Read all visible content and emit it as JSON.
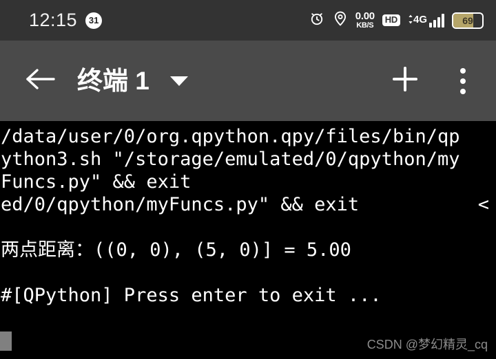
{
  "status_bar": {
    "clock": "12:15",
    "notification_count": "31",
    "alarm_icon": "alarm-clock-icon",
    "location_icon": "location-pin-icon",
    "network_speed_value": "0.00",
    "network_speed_unit": "KB/S",
    "hd_label": "HD",
    "network_type": "4G",
    "signal_bars": 4,
    "battery_level": "69",
    "battery_percent": 69,
    "battery_color": "#b5a569",
    "background_color": "#333333"
  },
  "app_bar": {
    "back_icon": "back-arrow-icon",
    "title": "终端 1",
    "dropdown_icon": "chevron-down-icon",
    "add_icon": "plus-icon",
    "overflow_icon": "more-vertical-icon",
    "background_color": "#4a4a4a"
  },
  "terminal": {
    "background_color": "#000000",
    "text_color": "#ffffff",
    "cursor_color": "#808080",
    "lines": [
      {
        "text": "/data/user/0/org.qpython.qpy/files/bin/qp",
        "tail": ""
      },
      {
        "text": "ython3.sh \"/storage/emulated/0/qpython/my",
        "tail": ""
      },
      {
        "text": "Funcs.py\" && exit",
        "tail": ""
      },
      {
        "text": "ed/0/qpython/myFuncs.py\" && exit",
        "tail": "<"
      },
      {
        "text": "",
        "tail": ""
      },
      {
        "text": "两点距离：((0, 0), (5, 0)] = 5.00",
        "tail": ""
      },
      {
        "text": "",
        "tail": ""
      },
      {
        "text": "#[QPython] Press enter to exit ...",
        "tail": ""
      }
    ]
  },
  "watermark": {
    "text": "CSDN @梦幻精灵_cq"
  }
}
